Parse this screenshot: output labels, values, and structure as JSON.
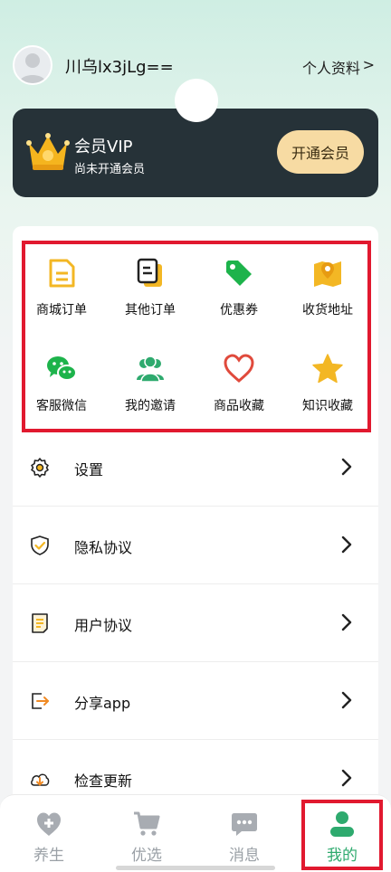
{
  "header": {
    "username": "川乌lx3jLg==",
    "profile_link": "个人资料",
    "profile_chevron": ">"
  },
  "vip": {
    "title": "会员VIP",
    "subtitle": "尚未开通会员",
    "button": "开通会员"
  },
  "grid": {
    "items": [
      {
        "label": "商城订单",
        "icon": "document-icon"
      },
      {
        "label": "其他订单",
        "icon": "copy-doc-icon"
      },
      {
        "label": "优惠券",
        "icon": "tag-icon"
      },
      {
        "label": "收货地址",
        "icon": "map-icon"
      },
      {
        "label": "客服微信",
        "icon": "wechat-icon"
      },
      {
        "label": "我的邀请",
        "icon": "users-icon"
      },
      {
        "label": "商品收藏",
        "icon": "heart-icon"
      },
      {
        "label": "知识收藏",
        "icon": "star-icon"
      }
    ]
  },
  "list": {
    "items": [
      {
        "label": "设置",
        "icon": "gear-icon"
      },
      {
        "label": "隐私协议",
        "icon": "shield-icon"
      },
      {
        "label": "用户协议",
        "icon": "doc-lines-icon"
      },
      {
        "label": "分享app",
        "icon": "share-icon"
      },
      {
        "label": "检查更新",
        "icon": "cloud-download-icon"
      }
    ]
  },
  "tabbar": {
    "tabs": [
      {
        "label": "养生",
        "icon": "heart-plus-icon"
      },
      {
        "label": "优选",
        "icon": "cart-icon"
      },
      {
        "label": "消息",
        "icon": "chat-icon"
      },
      {
        "label": "我的",
        "icon": "user-icon"
      }
    ],
    "active_index": 3
  },
  "colors": {
    "accent_green": "#2eaa6e",
    "highlight_red": "#e1192f",
    "vip_card": "#263238",
    "vip_button": "#f7dba3",
    "icon_yellow": "#f3b724",
    "icon_green": "#1db34b",
    "icon_red": "#e04a3c"
  }
}
